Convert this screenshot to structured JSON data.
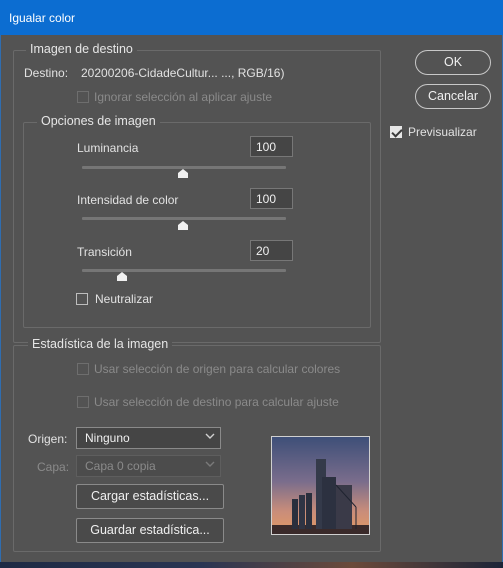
{
  "window": {
    "title": "Igualar color"
  },
  "target_image": {
    "legend": "Imagen de destino",
    "destination_label": "Destino:",
    "destination_value": "20200206-CidadeCultur... ..., RGB/16)",
    "ignore_selection_label": "Ignorar selección al aplicar ajuste"
  },
  "image_options": {
    "legend": "Opciones de imagen",
    "luminance": {
      "label": "Luminancia",
      "value": "100",
      "slider_fraction": 0.5
    },
    "color_intensity": {
      "label": "Intensidad de color",
      "value": "100",
      "slider_fraction": 0.5
    },
    "fade": {
      "label": "Transición",
      "value": "20",
      "slider_fraction": 0.2
    },
    "neutralize_label": "Neutralizar"
  },
  "buttons": {
    "ok": "OK",
    "cancel": "Cancelar"
  },
  "preview_checkbox": {
    "label": "Previsualizar",
    "checked": true
  },
  "image_stats": {
    "legend": "Estadística de la imagen",
    "use_source_selection": "Usar selección de origen para calcular colores",
    "use_target_selection": "Usar selección de destino para calcular ajuste",
    "source_label": "Origen:",
    "source_value": "Ninguno",
    "layer_label": "Capa:",
    "layer_value": "Capa 0 copia",
    "load_button": "Cargar estadísticas...",
    "save_button": "Guardar estadística..."
  },
  "colors": {
    "titlebar": "#0c6dd1",
    "panel": "#535353"
  },
  "icons": [
    "chevron-down-icon",
    "checkmark-icon"
  ]
}
